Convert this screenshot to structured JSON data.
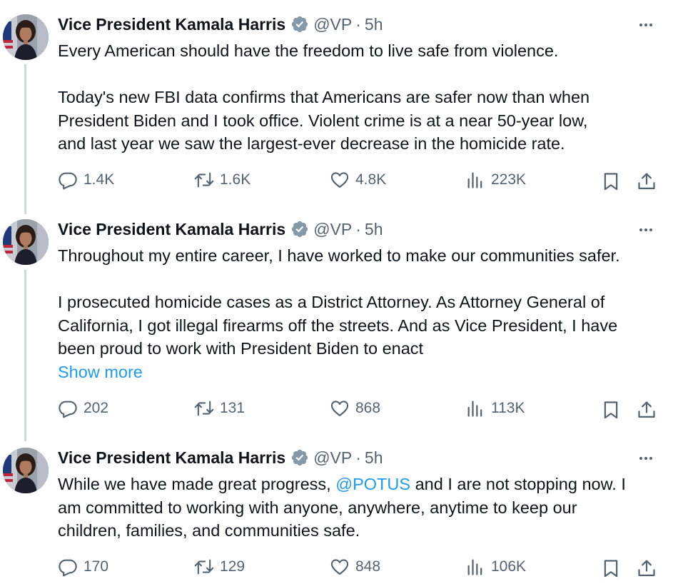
{
  "tweets": [
    {
      "author_name": "Vice President Kamala Harris",
      "handle": "@VP",
      "separator": "·",
      "time": "5h",
      "lines_para1": [
        "Every American should have the freedom to live safe from violence."
      ],
      "lines_para2": [
        "Today's new FBI data confirms that Americans are safer now than when",
        "President Biden and I took office. Violent crime is at a near 50-year low,",
        "and last year we saw the largest-ever decrease in the homicide rate."
      ],
      "replies": "1.4K",
      "reposts": "1.6K",
      "likes": "4.8K",
      "views": "223K"
    },
    {
      "author_name": "Vice President Kamala Harris",
      "handle": "@VP",
      "separator": "·",
      "time": "5h",
      "lines_para1": [
        "Throughout my entire career, I have worked to make our communities safer."
      ],
      "lines_para2": [
        "I prosecuted homicide cases as a District Attorney. As Attorney General of",
        "California, I got illegal firearms off the streets. And as Vice President, I have",
        "been proud to work with President Biden to enact"
      ],
      "show_more": "Show more",
      "replies": "202",
      "reposts": "131",
      "likes": "868",
      "views": "113K"
    },
    {
      "author_name": "Vice President Kamala Harris",
      "handle": "@VP",
      "separator": "·",
      "time": "5h",
      "line1_before": "While we have made great progress, ",
      "line1_mention": "@POTUS",
      "line1_after": " and I are not stopping now. I",
      "lines_rest": [
        "am committed to working with anyone, anywhere, anytime to keep our",
        "children, families, and communities safe."
      ],
      "replies": "170",
      "reposts": "129",
      "likes": "848",
      "views": "106K"
    }
  ],
  "icons": {
    "verified": "verified-badge-icon",
    "more": "more-horizontal-icon",
    "reply": "reply-icon",
    "repost": "repost-icon",
    "like": "heart-icon",
    "views": "views-icon",
    "bookmark": "bookmark-icon",
    "share": "share-icon"
  },
  "colors": {
    "text": "#0f1419",
    "secondary": "#536471",
    "link": "#1d9bf0",
    "thread_line": "#cfd9de",
    "badge": "#829aab"
  }
}
